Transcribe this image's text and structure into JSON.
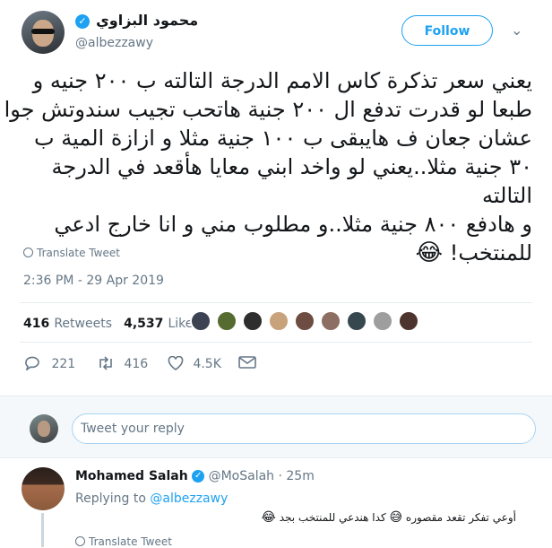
{
  "author": {
    "name": "محمود البزاوي",
    "handle": "@albezzawy",
    "verified_glyph": "✓"
  },
  "follow_label": "Follow",
  "chevron_glyph": "⌄",
  "tweet": {
    "lines": [
      "يعني سعر تذكرة كاس الامم الدرجة التالته ب ٢٠٠ جنيه و",
      "طبعا لو قدرت تدفع ال ٢٠٠ جنية هاتحب تجيب سندوتش جوا",
      "عشان جعان ف هايبقى ب ١٠٠ جنية مثلا و ازازة المية ب",
      "٣٠ جنية مثلا..يعني لو واخد ابني معايا هأقعد في الدرجة التالته",
      "و هادفع ٨٠٠ جنية مثلا..و مطلوب مني و انا خارج ادعي",
      "للمنتخب!"
    ],
    "emoji": "😂"
  },
  "translate_label": "Translate Tweet",
  "timestamp": "2:36 PM - 29 Apr 2019",
  "stats": {
    "retweets_count": "416",
    "retweets_label": "Retweets",
    "likes_count": "4,537",
    "likes_label": "Likes"
  },
  "liker_avatar_colors": [
    "#3b4252",
    "#556b2f",
    "#2e2e2e",
    "#c8a27a",
    "#6d4c41",
    "#8d6e63",
    "#37474f",
    "#9e9e9e",
    "#4e342e"
  ],
  "actions": {
    "replies": "221",
    "retweets": "416",
    "likes": "4.5K"
  },
  "reply_box": {
    "placeholder": "Tweet your reply"
  },
  "reply": {
    "name": "Mohamed Salah",
    "handle": "@MoSalah",
    "time": "· 25m",
    "replying_prefix": "Replying to",
    "replying_to": "@albezzawy",
    "text_part1": "أوعي تفكر تقعد مقصوره",
    "emoji1": "😅",
    "text_part2": "كدا هندعي للمنتخب بجد",
    "emoji2": "😂",
    "translate_label": "Translate Tweet"
  },
  "colors": {
    "accent": "#1da1f2",
    "muted": "#657786",
    "border": "#e6ecf0"
  }
}
